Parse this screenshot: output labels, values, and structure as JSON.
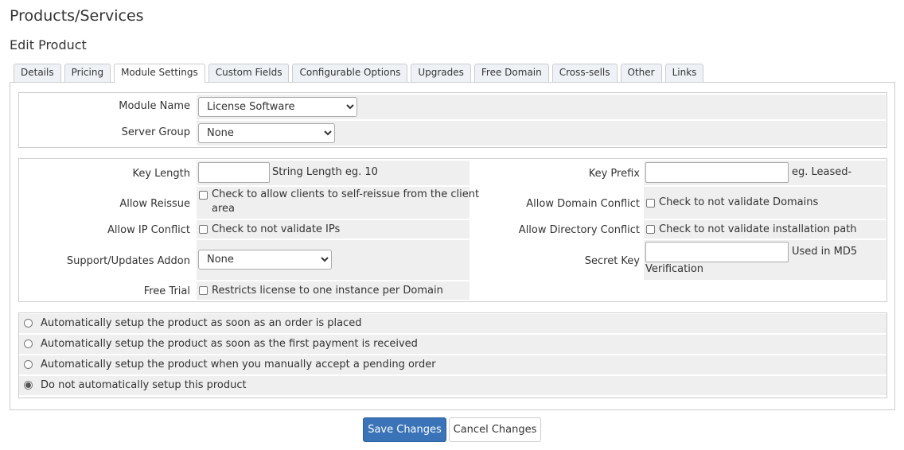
{
  "header": {
    "title": "Products/Services",
    "subtitle": "Edit Product"
  },
  "tabs": [
    {
      "label": "Details"
    },
    {
      "label": "Pricing"
    },
    {
      "label": "Module Settings",
      "active": true
    },
    {
      "label": "Custom Fields"
    },
    {
      "label": "Configurable Options"
    },
    {
      "label": "Upgrades"
    },
    {
      "label": "Free Domain"
    },
    {
      "label": "Cross-sells"
    },
    {
      "label": "Other"
    },
    {
      "label": "Links"
    }
  ],
  "module": {
    "name_label": "Module Name",
    "name_value": "License Software",
    "server_group_label": "Server Group",
    "server_group_value": "None"
  },
  "settings": {
    "key_length_label": "Key Length",
    "key_length_hint": "String Length eg. 10",
    "key_prefix_label": "Key Prefix",
    "key_prefix_hint": "eg. Leased-",
    "allow_reissue_label": "Allow Reissue",
    "allow_reissue_text_1": "Check to allow clients to self-reissue from the client",
    "allow_reissue_text_2": "area",
    "allow_domain_conflict_label": "Allow Domain Conflict",
    "allow_domain_conflict_text": "Check to not validate Domains",
    "allow_ip_conflict_label": "Allow IP Conflict",
    "allow_ip_conflict_text": "Check to not validate IPs",
    "allow_directory_conflict_label": "Allow Directory Conflict",
    "allow_directory_conflict_text": "Check to not validate installation path",
    "support_addon_label": "Support/Updates Addon",
    "support_addon_value": "None",
    "secret_key_label": "Secret Key",
    "secret_key_hint_1": "Used in MD5",
    "secret_key_hint_2": "Verification",
    "free_trial_label": "Free Trial",
    "free_trial_text": "Restricts license to one instance per Domain"
  },
  "setup_options": [
    {
      "label": "Automatically setup the product as soon as an order is placed",
      "checked": false
    },
    {
      "label": "Automatically setup the product as soon as the first payment is received",
      "checked": false
    },
    {
      "label": "Automatically setup the product when you manually accept a pending order",
      "checked": false
    },
    {
      "label": "Do not automatically setup this product",
      "checked": true
    }
  ],
  "buttons": {
    "save": "Save Changes",
    "cancel": "Cancel Changes"
  }
}
